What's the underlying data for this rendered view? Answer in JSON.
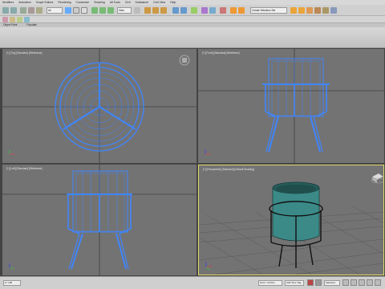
{
  "menubar": {
    "items": [
      "Modifiers",
      "Animation",
      "Graph Editors",
      "Rendering",
      "Customize",
      "Scripting",
      "Alt Tools",
      "Civil",
      "Substance",
      "Civil View",
      "Help"
    ]
  },
  "toolbar": {
    "selection_filter": "All",
    "view_dropdown": "View",
    "workspace_dropdown": "Create Selection Set"
  },
  "ribbon": {
    "tabs": [
      "Object Paint",
      "Populate"
    ]
  },
  "viewports": {
    "top": {
      "label": "[+] [Top] [Standard] [Wireframe]"
    },
    "front": {
      "label": "[+] [Front] [Standard] [Wireframe]"
    },
    "left": {
      "label": "[+] [Left] [Standard] [Wireframe]"
    },
    "perspective": {
      "label": "[+] [Perspective] [Standard] [Default Shading]"
    }
  },
  "status": {
    "frame": "0 / 100",
    "grid": "Grid = 10.0cm",
    "add_time_tag": "Add Time Tag",
    "auto_key": "Auto Key",
    "selected": "Selected",
    "set_key": "Set Key",
    "key_filters": "Key Filters..."
  },
  "colors": {
    "wireframe": "#3f86ff",
    "viewport_bg": "#737373",
    "active_border": "#e3dd6e",
    "pot_teal": "#3b8a88"
  }
}
